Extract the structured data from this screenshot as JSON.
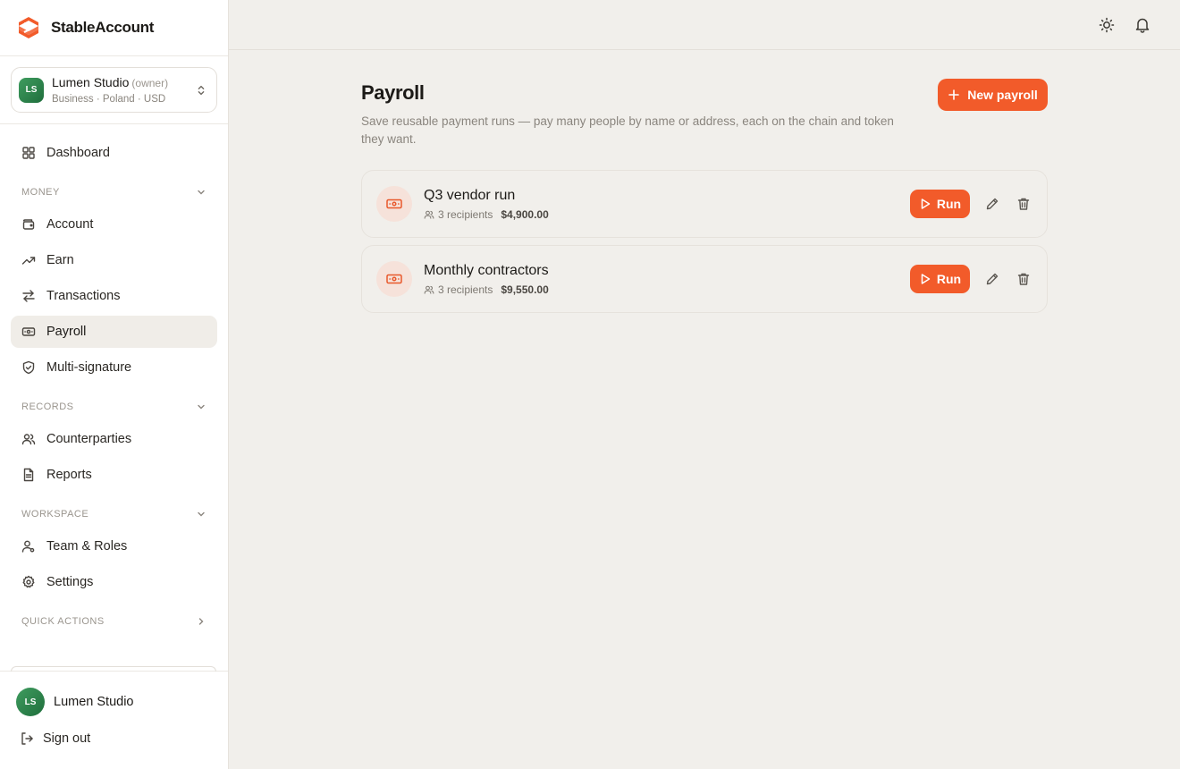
{
  "brand": {
    "name": "StableAccount",
    "accent": "#f25b2a"
  },
  "workspace": {
    "initials": "LS",
    "name": "Lumen Studio",
    "role": "(owner)",
    "meta": "Business · Poland · USD"
  },
  "nav": {
    "dashboard": "Dashboard",
    "sections": {
      "money": "MONEY",
      "records": "RECORDS",
      "workspace": "WORKSPACE",
      "quick_actions": "QUICK ACTIONS"
    },
    "items": {
      "account": "Account",
      "earn": "Earn",
      "transactions": "Transactions",
      "payroll": "Payroll",
      "multisig": "Multi-signature",
      "counterparties": "Counterparties",
      "reports": "Reports",
      "team": "Team & Roles",
      "settings": "Settings"
    }
  },
  "user": {
    "initials": "LS",
    "name": "Lumen Studio",
    "signout": "Sign out"
  },
  "page": {
    "title": "Payroll",
    "subtitle": "Save reusable payment runs — pay many people by name or address, each on the chain and token they want.",
    "new_button": "New payroll"
  },
  "payrolls": [
    {
      "name": "Q3 vendor run",
      "recipients": "3 recipients",
      "amount": "$4,900.00",
      "run_label": "Run"
    },
    {
      "name": "Monthly contractors",
      "recipients": "3 recipients",
      "amount": "$9,550.00",
      "run_label": "Run"
    }
  ]
}
